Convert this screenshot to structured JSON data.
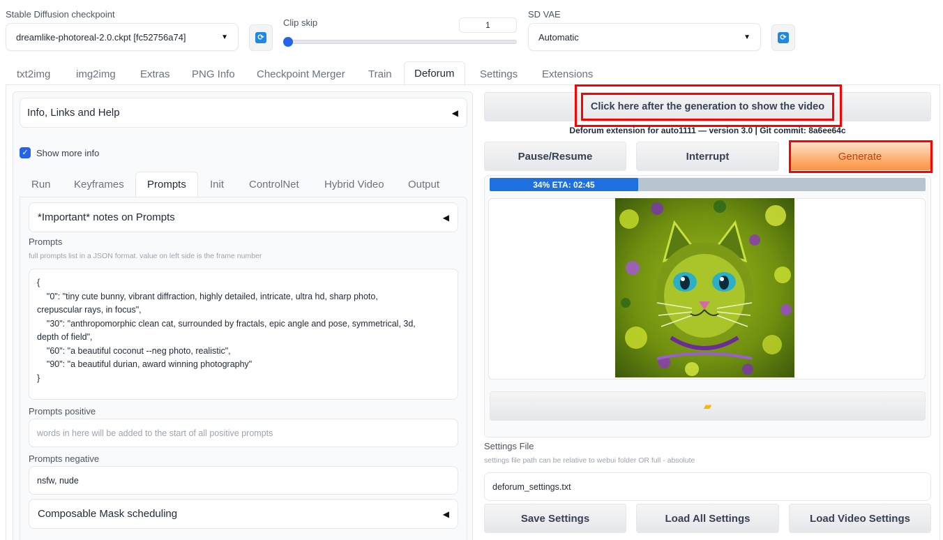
{
  "top": {
    "checkpoint_label": "Stable Diffusion checkpoint",
    "checkpoint_value": "dreamlike-photoreal-2.0.ckpt [fc52756a74]",
    "clip_skip_label": "Clip skip",
    "clip_skip_value": "1",
    "clip_skip_fraction": 0.0,
    "vae_label": "SD VAE",
    "vae_value": "Automatic",
    "refresh_icon": "refresh-icon"
  },
  "main_tabs": [
    "txt2img",
    "img2img",
    "Extras",
    "PNG Info",
    "Checkpoint Merger",
    "Train",
    "Deforum",
    "Settings",
    "Extensions"
  ],
  "main_tab_active": "Deforum",
  "left": {
    "info_accordion": "Info, Links and Help",
    "show_more_info": "Show more info",
    "show_more_checked": true,
    "subtabs": [
      "Run",
      "Keyframes",
      "Prompts",
      "Init",
      "ControlNet",
      "Hybrid Video",
      "Output"
    ],
    "subtab_active": "Prompts",
    "notes_accordion": "*Important* notes on Prompts",
    "prompts_label": "Prompts",
    "prompts_hint": "full prompts list in a JSON format.  value on left side is the frame number",
    "prompts_value": "{\n    \"0\": \"tiny cute bunny, vibrant diffraction, highly detailed, intricate, ultra hd, sharp photo,\ncrepuscular rays, in focus\",\n    \"30\": \"anthropomorphic clean cat, surrounded by fractals, epic angle and pose, symmetrical, 3d,\ndepth of field\",\n    \"60\": \"a beautiful coconut --neg photo, realistic\",\n    \"90\": \"a beautiful durian, award winning photography\"\n}",
    "positive_label": "Prompts positive",
    "positive_placeholder": "words in here will be added to the start of all positive prompts",
    "negative_label": "Prompts negative",
    "negative_value": "nsfw, nude",
    "mask_accordion": "Composable Mask scheduling"
  },
  "right": {
    "show_video_button": "Click here after the generation to show the video",
    "version_text": "Deforum extension for auto1111 — version 3.0 | Git commit: 8a6ee64c",
    "pause_button": "Pause/Resume",
    "interrupt_button": "Interrupt",
    "generate_button": "Generate",
    "progress_text": "34% ETA: 02:45",
    "progress_fraction": 0.34,
    "folder_icon": "folder-icon",
    "settings_file_label": "Settings File",
    "settings_file_hint": "settings file path can be relative to webui folder OR full - absolute",
    "settings_file_value": "deforum_settings.txt",
    "save_button": "Save Settings",
    "load_all_button": "Load All Settings",
    "load_video_button": "Load Video Settings"
  },
  "colors": {
    "accent": "#2563eb",
    "generate": "#fb923c",
    "highlight": "#ff0000"
  }
}
